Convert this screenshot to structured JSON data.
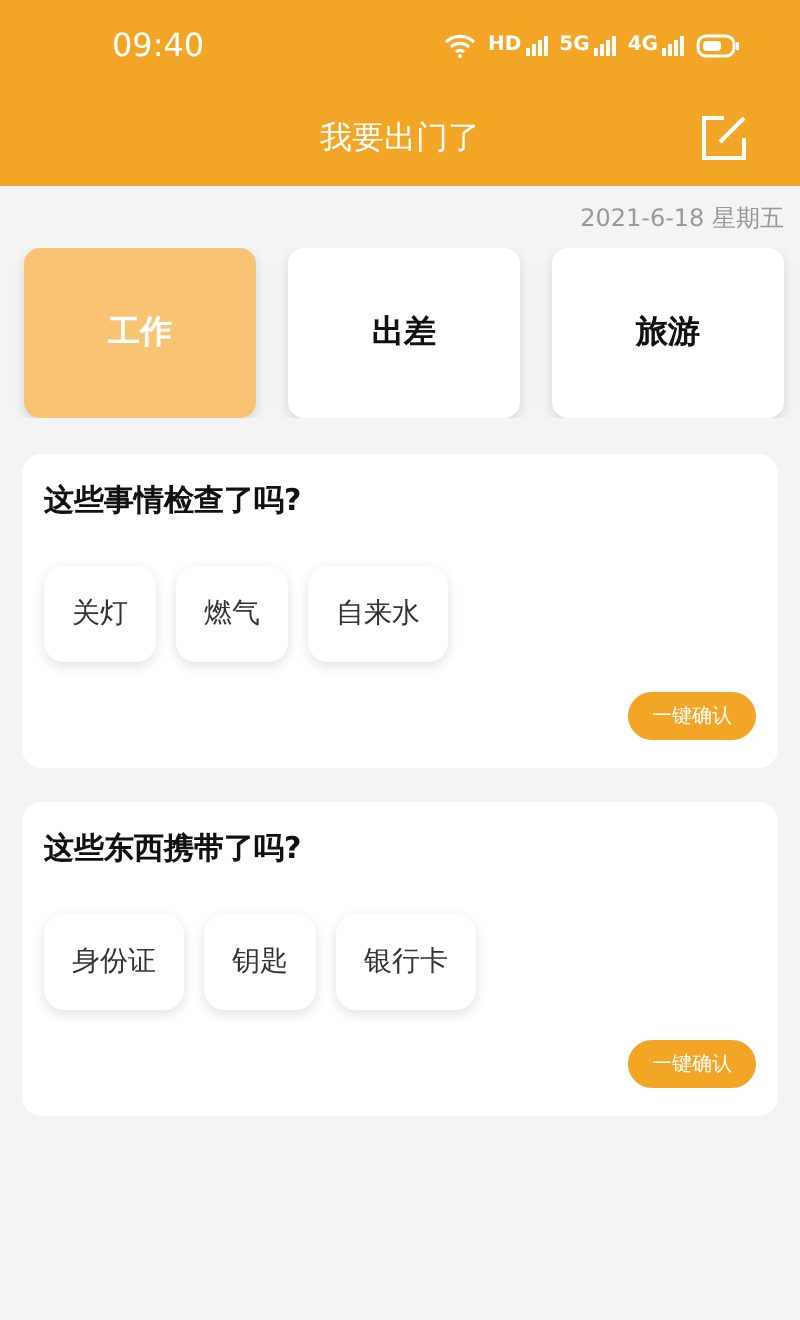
{
  "status_bar": {
    "time": "09:40",
    "network_labels": [
      "HD",
      "5G",
      "4G"
    ]
  },
  "header": {
    "title": "我要出门了"
  },
  "date": "2021-6-18 星期五",
  "categories": [
    {
      "label": "工作",
      "selected": true
    },
    {
      "label": "出差",
      "selected": false
    },
    {
      "label": "旅游",
      "selected": false
    }
  ],
  "sections": [
    {
      "title": "这些事情检查了吗?",
      "items": [
        "关灯",
        "燃气",
        "自来水"
      ],
      "button": "一键确认"
    },
    {
      "title": "这些东西携带了吗?",
      "items": [
        "身份证",
        "钥匙",
        "银行卡"
      ],
      "button": "一键确认"
    }
  ]
}
